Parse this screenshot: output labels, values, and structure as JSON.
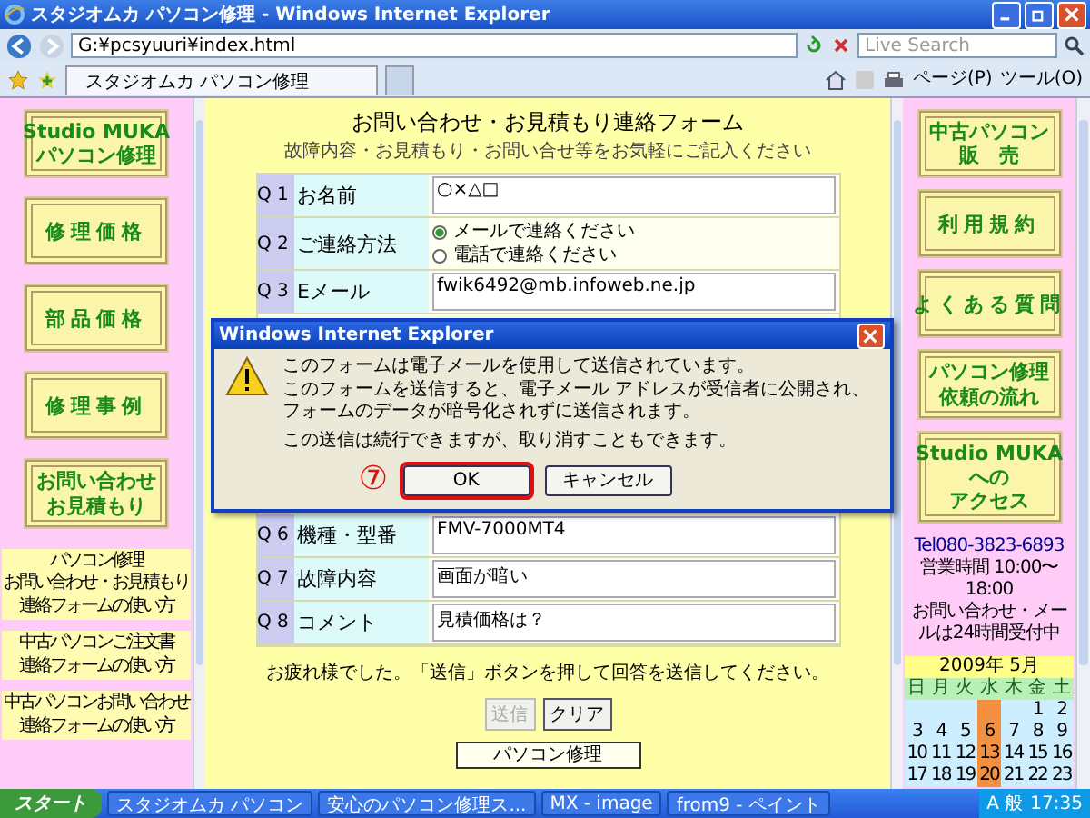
{
  "window": {
    "title": "スタジオムカ パソコン修理 - Windows Internet Explorer"
  },
  "address_bar": {
    "url": "G:¥pcsyuuri¥index.html"
  },
  "search": {
    "placeholder": "Live Search"
  },
  "tabs": [
    {
      "label": "スタジオムカ パソコン修理",
      "selected": true
    }
  ],
  "toolbar": {
    "items": [
      "ページ(P)",
      "ツール(O)"
    ]
  },
  "left_sidebar": {
    "buttons": [
      {
        "lines": [
          "Studio MUKA",
          "パソコン修理"
        ]
      },
      {
        "lines": [
          "修理価格"
        ]
      },
      {
        "lines": [
          "部品価格"
        ]
      },
      {
        "lines": [
          "修理事例"
        ]
      },
      {
        "lines": [
          "お問い合わせ",
          "お見積もり"
        ]
      }
    ],
    "links": [
      {
        "lines": [
          "パソコン修理",
          "お問い合わせ・お見積もり",
          "連絡フォームの使い方"
        ]
      },
      {
        "lines": [
          "中古パソコンご注文書",
          "連絡フォームの使い方"
        ]
      },
      {
        "lines": [
          "中古パソコンお問い合わせ",
          "連絡フォームの使い方"
        ]
      }
    ]
  },
  "form": {
    "title": "お問い合わせ・お見積もり連絡フォーム",
    "subtitle": "故障内容・お見積もり・お問い合せ等をお気軽にご記入ください",
    "questions_above": [
      {
        "number": "Q 1",
        "label": "お名前",
        "kind": "text",
        "value": "○×△□"
      },
      {
        "number": "Q 2",
        "label": "ご連絡方法",
        "kind": "radio",
        "options": [
          {
            "label": "メールで連絡ください",
            "selected": true
          },
          {
            "label": "電話で連絡ください",
            "selected": false
          }
        ]
      },
      {
        "number": "Q 3",
        "label": "Eメール",
        "kind": "text",
        "value": "fwik6492@mb.infoweb.ne.jp"
      }
    ],
    "questions_below": [
      {
        "number": "Q 6",
        "label": "機種・型番",
        "kind": "text",
        "value": "FMV-7000MT4"
      },
      {
        "number": "Q 7",
        "label": "故障内容",
        "kind": "text",
        "value": "画面が暗い"
      },
      {
        "number": "Q 8",
        "label": "コメント",
        "kind": "text",
        "value": "見積価格は？"
      }
    ],
    "closing": "お疲れ様でした。「送信」ボタンを押して回答を送信してください。",
    "buttons": [
      {
        "label": "送信",
        "disabled": true
      },
      {
        "label": "クリア",
        "disabled": false
      }
    ],
    "bottom_link": "パソコン修理"
  },
  "dialog": {
    "title": "Windows Internet Explorer",
    "lines": [
      "このフォームは電子メールを使用して送信されています。",
      "このフォームを送信すると、電子メール アドレスが受信者に公開され、フォームのデータが暗号化されずに送信されます。"
    ],
    "note": "この送信は続行できますが、取り消すこともできます。",
    "annotation": "⑦",
    "buttons": [
      {
        "label": "OK",
        "highlighted": true
      },
      {
        "label": "キャンセル",
        "highlighted": false
      }
    ]
  },
  "right_sidebar": {
    "buttons": [
      {
        "lines": [
          "中古パソコン",
          "販　売"
        ]
      },
      {
        "lines": [
          "利用規約"
        ]
      },
      {
        "lines": [
          "よくある質問"
        ]
      },
      {
        "lines": [
          "パソコン修理",
          "依頼の流れ"
        ]
      },
      {
        "lines": [
          "Studio MUKA",
          "への",
          "アクセス"
        ]
      }
    ],
    "contact": [
      "Tel080-3823-6893",
      "営業時間 10:00〜18:00",
      "お問い合わせ・メールは24時間受付中"
    ],
    "calendar": {
      "title": "2009年 5月",
      "weekdays": [
        "日",
        "月",
        "火",
        "水",
        "木",
        "金",
        "土"
      ],
      "weeks": [
        [
          {
            "holiday": false
          },
          {
            "holiday": false
          },
          {
            "holiday": false
          },
          {
            "holiday": true
          },
          {
            "holiday": false
          },
          {
            "day": "1",
            "holiday": false
          },
          {
            "day": "2",
            "holiday": false
          }
        ],
        [
          {
            "day": "3",
            "holiday": false
          },
          {
            "day": "4",
            "holiday": false
          },
          {
            "day": "5",
            "holiday": false
          },
          {
            "day": "6",
            "holiday": true
          },
          {
            "day": "7",
            "holiday": false
          },
          {
            "day": "8",
            "holiday": false
          },
          {
            "day": "9",
            "holiday": false
          }
        ],
        [
          {
            "day": "10",
            "holiday": false
          },
          {
            "day": "11",
            "holiday": false
          },
          {
            "day": "12",
            "holiday": false
          },
          {
            "day": "13",
            "holiday": true
          },
          {
            "day": "14",
            "holiday": false
          },
          {
            "day": "15",
            "holiday": false
          },
          {
            "day": "16",
            "holiday": false
          }
        ],
        [
          {
            "day": "17",
            "holiday": false
          },
          {
            "day": "18",
            "holiday": false
          },
          {
            "day": "19",
            "holiday": false
          },
          {
            "day": "20",
            "holiday": true
          },
          {
            "day": "21",
            "holiday": false
          },
          {
            "day": "22",
            "holiday": false
          },
          {
            "day": "23",
            "holiday": false
          }
        ]
      ]
    }
  },
  "taskbar": {
    "start": "スタート",
    "tasks": [
      "スタジオムカ パソコン",
      "安心のパソコン修理ス...",
      "MX - image",
      "from9 - ペイント"
    ],
    "ime": "A 般",
    "clock": "17:35"
  }
}
